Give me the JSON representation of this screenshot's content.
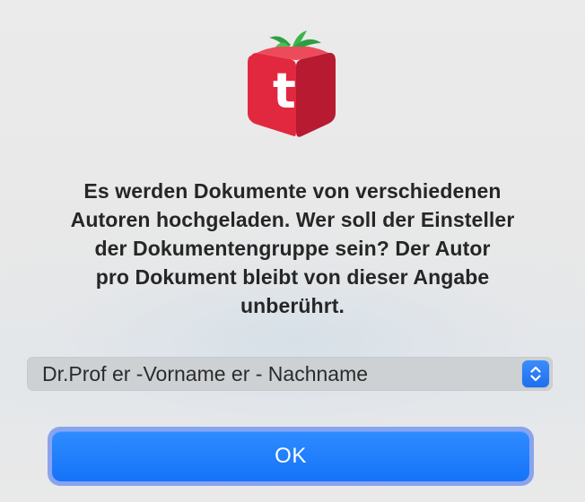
{
  "dialog": {
    "logo_letter": "t",
    "message_lines": [
      "Es werden Dokumente von verschiedenen",
      "Autoren hochgeladen. Wer soll der Einsteller",
      "der Dokumentengruppe sein? Der Autor",
      "pro Dokument bleibt von dieser Angabe",
      "unberührt."
    ],
    "author_popup": {
      "selected": "Dr.Prof er -Vorname er - Nachname"
    },
    "ok_label": "OK"
  },
  "colors": {
    "logo_red": "#e2283f",
    "logo_dark_red": "#b81a31",
    "logo_leaf": "#3bb54a",
    "accent_blue": "#1877f8",
    "focus_ring": "#8aa3ee"
  }
}
